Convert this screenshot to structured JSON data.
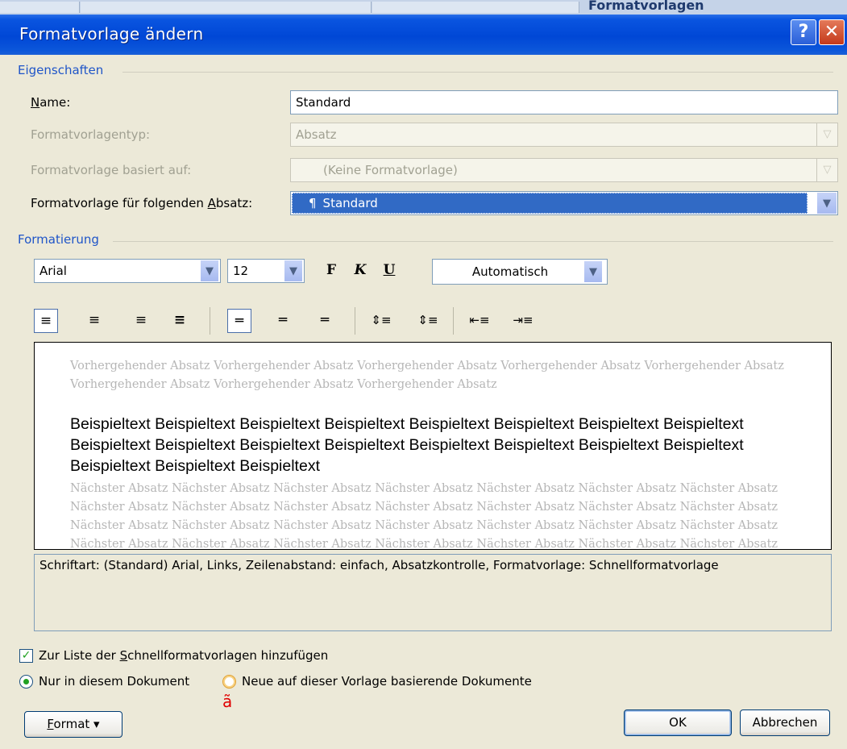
{
  "background_app": {
    "panel_label": "Formatvorlagen"
  },
  "window": {
    "title": "Formatvorlage ändern",
    "help_label": "?",
    "close_label": "✕"
  },
  "eigenschaften": {
    "group_label": "Eigenschaften",
    "name_label": "Name:",
    "name_value": "Standard",
    "type_label": "Formatvorlagentyp:",
    "type_value": "Absatz",
    "based_label": "Formatvorlage basiert auf:",
    "based_value": "(Keine Formatvorlage)",
    "next_label_pre": "Formatvorlage für folgenden ",
    "next_label_u": "A",
    "next_label_post": "bsatz:",
    "next_value": "Standard",
    "next_icon_glyph": "¶"
  },
  "formatierung": {
    "group_label": "Formatierung",
    "font": "Arial",
    "size": "12",
    "bold_label": "F",
    "italic_label": "K",
    "underline_label": "U",
    "color": "Automatisch"
  },
  "preview": {
    "previous": "Vorhergehender Absatz Vorhergehender Absatz Vorhergehender Absatz Vorhergehender Absatz Vorhergehender Absatz Vorhergehender Absatz Vorhergehender Absatz Vorhergehender Absatz",
    "sample": "Beispieltext Beispieltext Beispieltext Beispieltext Beispieltext Beispieltext Beispieltext Beispieltext Beispieltext Beispieltext Beispieltext Beispieltext Beispieltext Beispieltext Beispieltext Beispieltext Beispieltext Beispieltext Beispieltext",
    "next": "Nächster Absatz Nächster Absatz Nächster Absatz Nächster Absatz Nächster Absatz Nächster Absatz Nächster Absatz Nächster Absatz Nächster Absatz Nächster Absatz Nächster Absatz Nächster Absatz Nächster Absatz Nächster Absatz Nächster Absatz Nächster Absatz Nächster Absatz Nächster Absatz Nächster Absatz Nächster Absatz Nächster Absatz Nächster Absatz Nächster Absatz Nächster Absatz Nächster Absatz Nächster Absatz Nächster Absatz Nächster Absatz"
  },
  "description": "Schriftart: (Standard) Arial, Links, Zeilenabstand:  einfach, Absatzkontrolle, Formatvorlage: Schnellformatvorlage",
  "options": {
    "quick_list_pre": "Zur Liste der ",
    "quick_list_u": "S",
    "quick_list_post": "chnellformatvorlagen hinzufügen",
    "quick_list_checked": true,
    "only_this_doc": "Nur in diesem Dokument",
    "new_docs": "Neue auf dieser Vorlage basierende Dokumente",
    "stray_char": "ã"
  },
  "buttons": {
    "format_u": "F",
    "format_rest": "ormat",
    "format_arrow": "▾",
    "ok": "OK",
    "cancel": "Abbrechen"
  }
}
